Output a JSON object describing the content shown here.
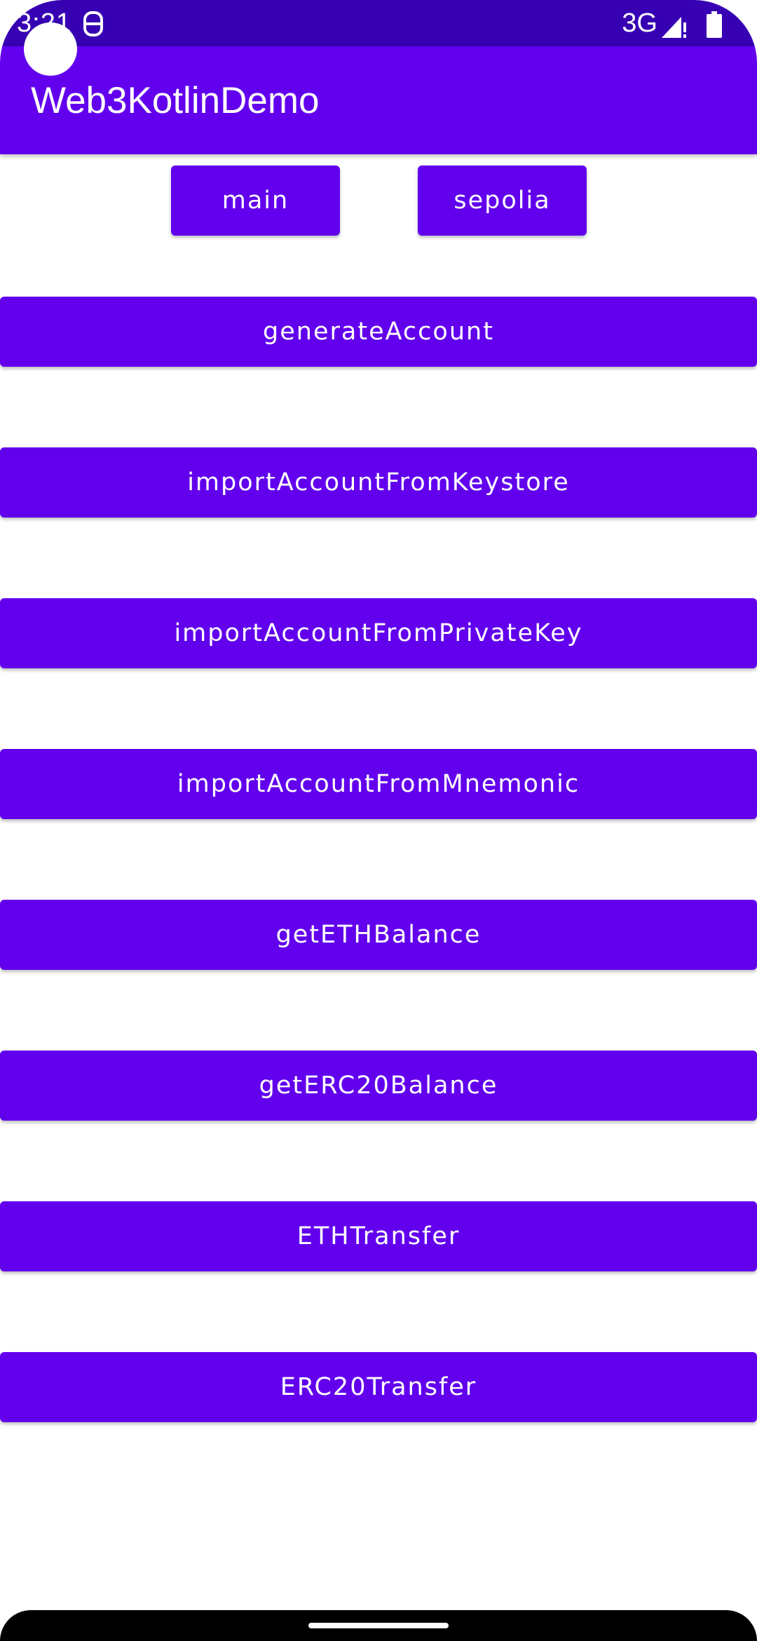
{
  "status_bar": {
    "time": "3:21",
    "network": "3G",
    "icons": [
      "notification-icon",
      "signal-icon",
      "battery-icon"
    ]
  },
  "app_bar": {
    "title": "Web3KotlinDemo"
  },
  "network_buttons": {
    "main": "main",
    "sepolia": "sepolia"
  },
  "actions": [
    {
      "label": "generateAccount"
    },
    {
      "label": "importAccountFromKeystore"
    },
    {
      "label": "importAccountFromPrivateKey"
    },
    {
      "label": "importAccountFromMnemonic"
    },
    {
      "label": "getETHBalance"
    },
    {
      "label": "getERC20Balance"
    },
    {
      "label": "ETHTransfer"
    },
    {
      "label": "ERC20Transfer"
    }
  ],
  "colors": {
    "primary": "#6200ee",
    "primary_dark": "#3700b3",
    "on_primary": "#ffffff"
  }
}
